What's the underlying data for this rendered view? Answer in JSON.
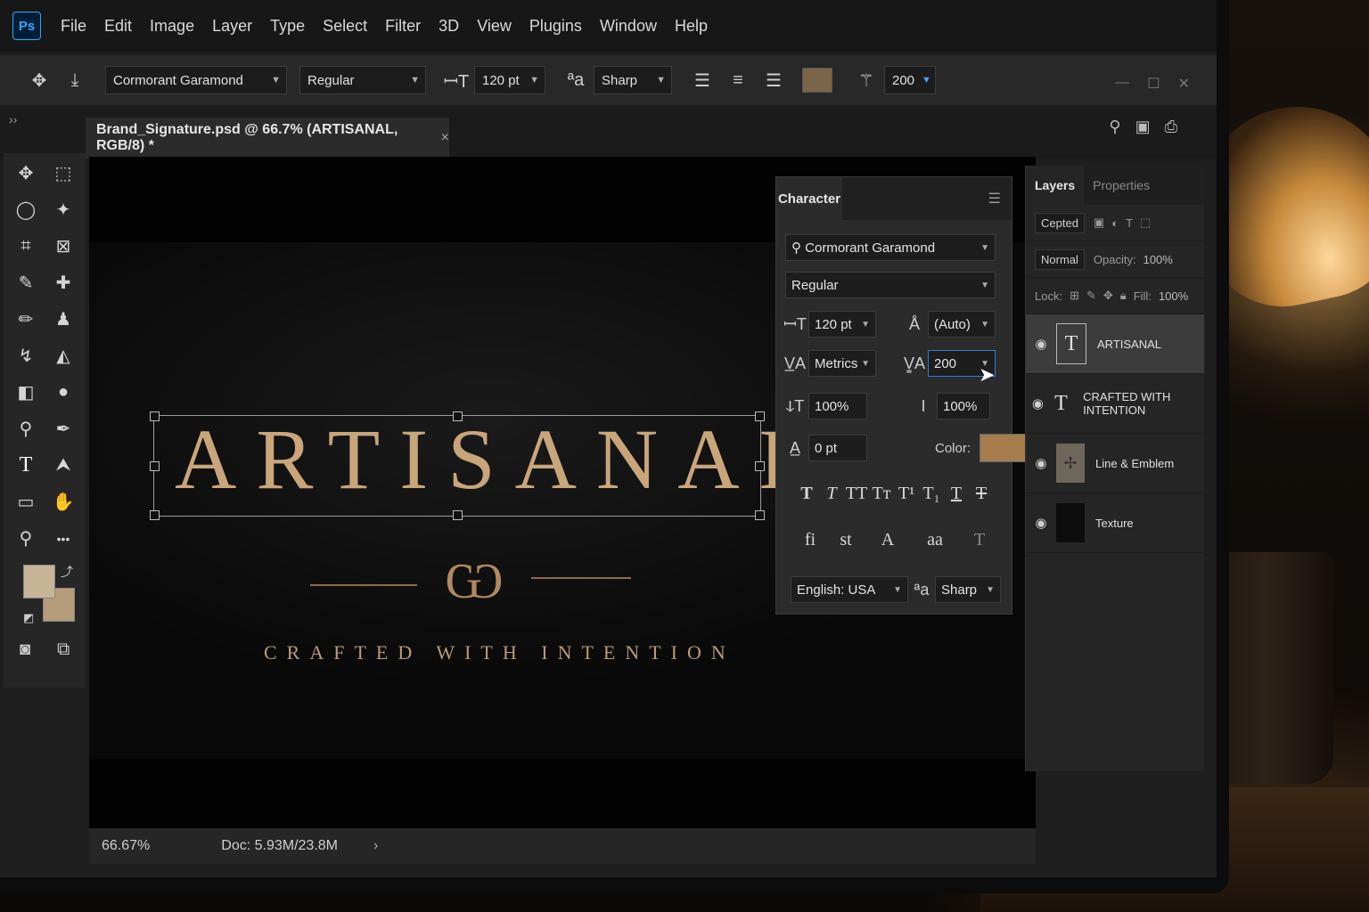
{
  "app": {
    "logo": "Ps",
    "menus": [
      "File",
      "Edit",
      "Image",
      "Layer",
      "Type",
      "Select",
      "Filter",
      "3D",
      "View",
      "Plugins",
      "Window",
      "Help"
    ]
  },
  "options": {
    "font_family": "Cormorant Garamond",
    "font_style": "Regular",
    "font_size": "120 pt",
    "anti_alias": "Sharp",
    "tracking": "200",
    "color": "#7a6548"
  },
  "document": {
    "tab_title": "Brand_Signature.psd @ 66.7% (ARTISANAL, RGB/8) *",
    "close": "×"
  },
  "canvas": {
    "headline": "ARTISANAL",
    "emblem": "Ѡ",
    "tagline": "CRAFTED WITH INTENTION"
  },
  "status": {
    "zoom": "66.67%",
    "doc": "Doc: 5.93M/23.8M",
    "arrow": "›"
  },
  "character": {
    "tab": "Character",
    "font_family": "Cormorant Garamond",
    "font_style": "Regular",
    "size": "120 pt",
    "leading": "(Auto)",
    "kerning": "Metrics",
    "tracking": "200",
    "vertical_scale": "100%",
    "horizontal_scale": "100%",
    "baseline_shift": "0 pt",
    "color_label": "Color:",
    "color": "#a67c4f",
    "style_buttons": [
      "T",
      "T",
      "TT",
      "Tт",
      "T¹",
      "T₁",
      "T",
      "T"
    ],
    "opentype_buttons": [
      "fi",
      "st",
      "A",
      "aa",
      "T"
    ],
    "language": "English: USA",
    "anti_alias": "Sharp"
  },
  "layers": {
    "tabs": [
      "Layers",
      "Properties"
    ],
    "filter": "Cepted",
    "blend_mode": "Normal",
    "opacity_label": "Opacity:",
    "opacity": "100%",
    "lock_label": "Lock:",
    "fill_label": "Fill:",
    "fill": "100%",
    "items": [
      {
        "name": "ARTISANAL",
        "thumb": "T",
        "kind": "type",
        "selected": true
      },
      {
        "name": "CRAFTED WITH INTENTION",
        "thumb": "T",
        "kind": "type",
        "selected": false
      },
      {
        "name": "Line & Emblem",
        "thumb": "✢",
        "kind": "emblem",
        "selected": false
      },
      {
        "name": "Texture",
        "thumb": "",
        "kind": "texture",
        "selected": false
      }
    ]
  },
  "icons": {
    "move": "✥",
    "marquee": "⬚",
    "lasso": "◯",
    "wand": "✦",
    "crop": "⌗",
    "frame": "⊠",
    "eyedropper": "✎",
    "heal": "✚",
    "brush": "✏",
    "stamp": "♟",
    "history": "↯",
    "eraser": "◭",
    "gradient": "◧",
    "blur": "💧",
    "dodge": "⚲",
    "pen": "✒",
    "type": "T",
    "path": "⮝",
    "shape": "▭",
    "hand": "✋",
    "zoom": "⚲",
    "more": "•••",
    "eye": "👁",
    "search": "⚲"
  }
}
